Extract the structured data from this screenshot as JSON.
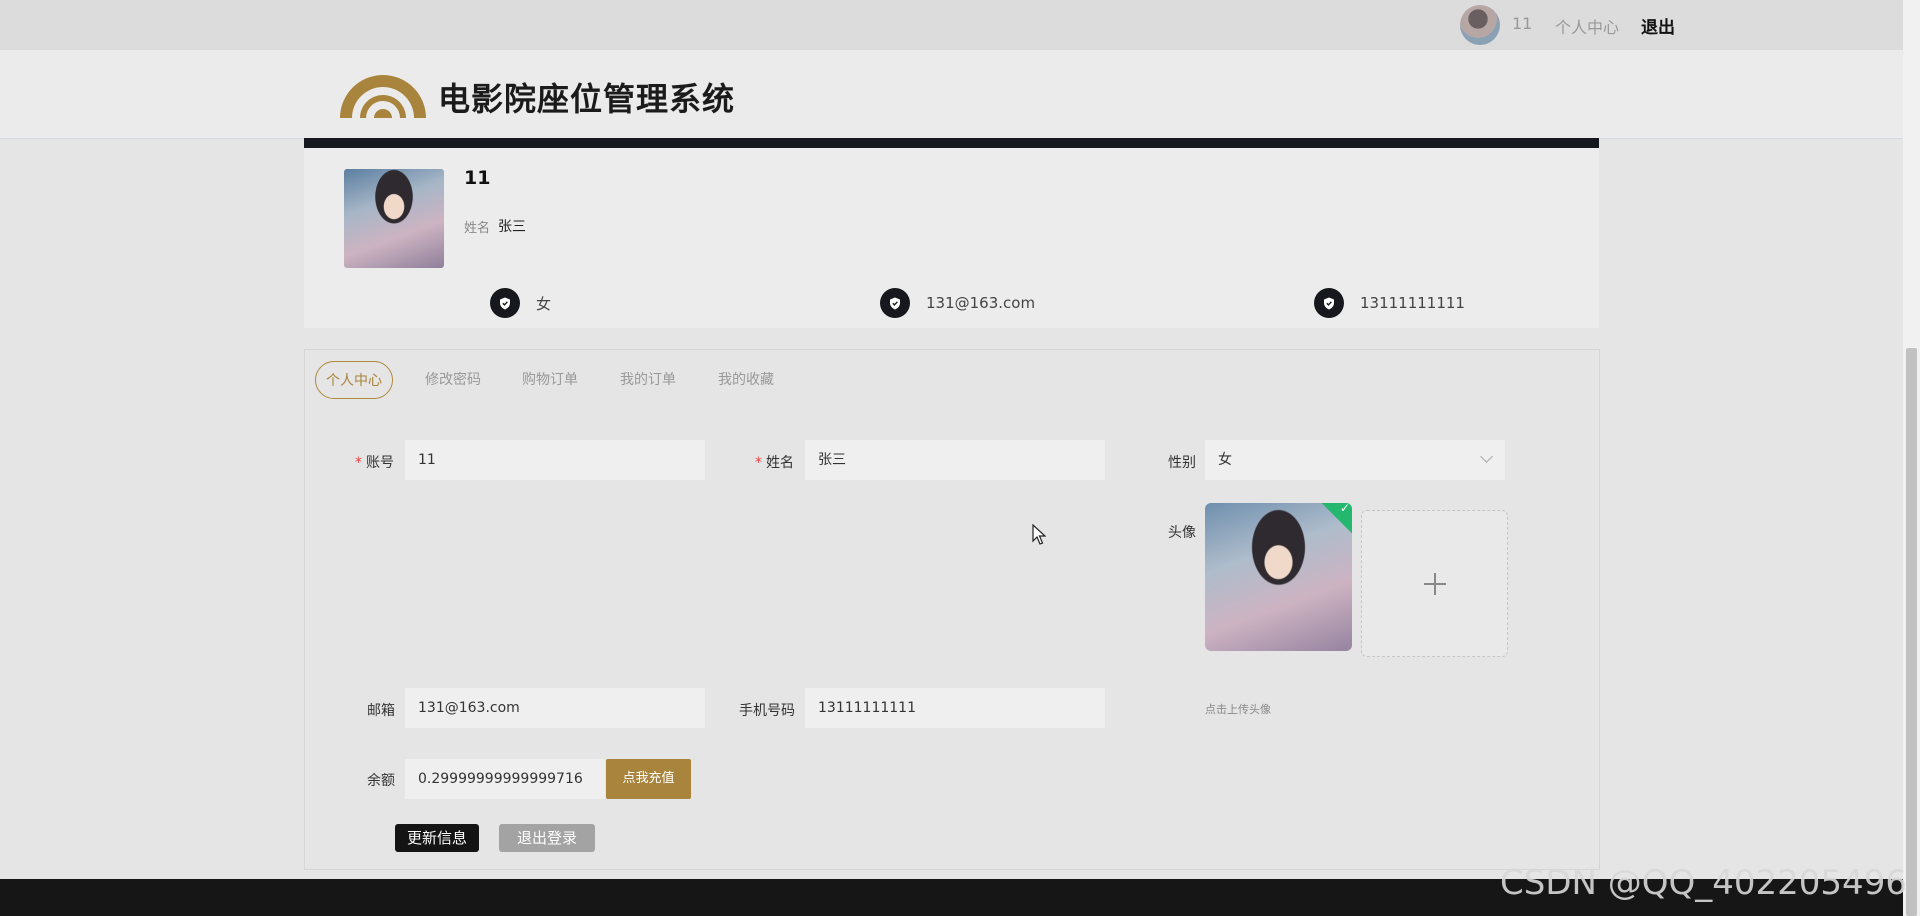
{
  "topbar": {
    "username": "11",
    "center_link": "个人中心",
    "logout_link": "退出"
  },
  "header": {
    "site_title": "电影院座位管理系统",
    "accent_color": "#a8843c"
  },
  "profile": {
    "username": "11",
    "name_label": "姓名",
    "name": "张三",
    "gender": "女",
    "email": "131@163.com",
    "phone": "13111111111",
    "info_icon": "shield-icon"
  },
  "tabs": [
    {
      "label": "个人中心",
      "active": true
    },
    {
      "label": "修改密码",
      "active": false
    },
    {
      "label": "购物订单",
      "active": false
    },
    {
      "label": "我的订单",
      "active": false
    },
    {
      "label": "我的收藏",
      "active": false
    }
  ],
  "form": {
    "required_mark": "*",
    "account": {
      "label": "账号",
      "value": "11"
    },
    "name": {
      "label": "姓名",
      "value": "张三"
    },
    "gender": {
      "label": "性别",
      "value": "女"
    },
    "avatar": {
      "label": "头像",
      "tip": "点击上传头像",
      "check_mark": "✓"
    },
    "email": {
      "label": "邮箱",
      "value": "131@163.com"
    },
    "phone": {
      "label": "手机号码",
      "value": "13111111111"
    },
    "balance": {
      "label": "余额",
      "value": "0.29999999999999716",
      "recharge_button": "点我充值"
    },
    "update_button": "更新信息",
    "logout_button": "退出登录"
  },
  "watermark": "CSDN @QQ_402205496"
}
